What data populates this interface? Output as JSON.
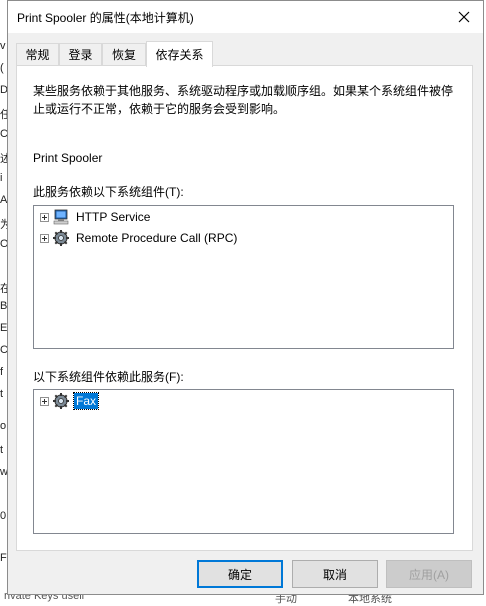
{
  "background": {
    "left_fragments": [
      "v",
      "(",
      "D",
      "任",
      "C",
      "述",
      "i",
      "A",
      "为",
      "O",
      "在",
      "B",
      "E",
      "C",
      "f",
      "t",
      "o",
      "t",
      "w",
      "0",
      "F"
    ],
    "bottom_fragments": [
      "rivate Keys usell",
      "手动",
      "本地系统"
    ]
  },
  "window": {
    "title": "Print Spooler 的属性(本地计算机)"
  },
  "tabs": [
    {
      "label": "常规"
    },
    {
      "label": "登录"
    },
    {
      "label": "恢复"
    },
    {
      "label": "依存关系"
    }
  ],
  "panel": {
    "description": "某些服务依赖于其他服务、系统驱动程序或加载顺序组。如果某个系统组件被停止或运行不正常，依赖于它的服务会受到影响。",
    "service_name": "Print Spooler",
    "depends_on_label": "此服务依赖以下系统组件(T):",
    "depends_on": [
      {
        "label": "HTTP Service",
        "icon": "computer-icon"
      },
      {
        "label": "Remote Procedure Call (RPC)",
        "icon": "gear-service-icon"
      }
    ],
    "dependents_label": "以下系统组件依赖此服务(F):",
    "dependents": [
      {
        "label": "Fax",
        "icon": "gear-service-icon",
        "selected": true
      }
    ]
  },
  "buttons": {
    "ok": "确定",
    "cancel": "取消",
    "apply": "应用(A)"
  },
  "colors": {
    "selection": "#0078d7",
    "dialog_bg": "#f0f0f0"
  }
}
